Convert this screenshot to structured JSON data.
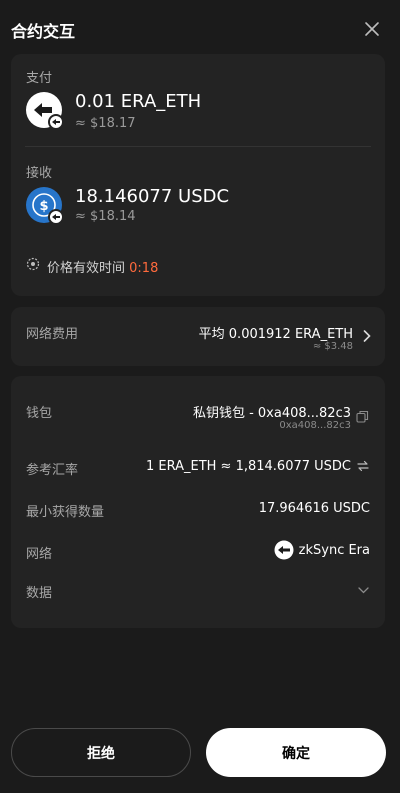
{
  "header": {
    "title": "合约交互",
    "close_icon": "close-icon"
  },
  "pay": {
    "label": "支付",
    "amount": "0.01 ERA_ETH",
    "usd": "≈ $18.17",
    "icon": "era-eth-token-icon"
  },
  "receive": {
    "label": "接收",
    "amount": "18.146077 USDC",
    "usd": "≈ $18.14",
    "icon": "usdc-token-icon"
  },
  "validity": {
    "label": "价格有效时间",
    "timer": "0:18",
    "timer_color": "#ff6a3d"
  },
  "fee": {
    "label": "网络费用",
    "value": "平均 0.001912 ERA_ETH",
    "usd": "≈ $3.48"
  },
  "details": {
    "wallet_label": "钱包",
    "wallet_value": "私钥钱包 - 0xa408...82c3",
    "wallet_sub": "0xa408...82c3",
    "rate_label": "参考汇率",
    "rate_value": "1 ERA_ETH ≈ 1,814.6077 USDC",
    "min_label": "最小获得数量",
    "min_value": "17.964616 USDC",
    "network_label": "网络",
    "network_value": "zkSync Era",
    "data_label": "数据"
  },
  "actions": {
    "reject": "拒绝",
    "confirm": "确定"
  },
  "colors": {
    "background": "#1b1b1b",
    "card": "#232323",
    "accent_timer": "#ff6a3d",
    "usdc_blue": "#2775ca"
  }
}
